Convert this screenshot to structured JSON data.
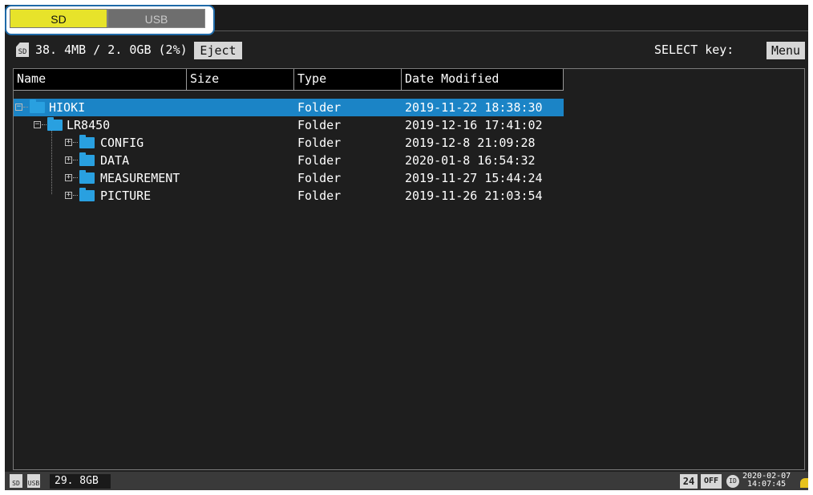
{
  "tabs": [
    {
      "label": "SD",
      "active": true
    },
    {
      "label": "USB",
      "active": false
    }
  ],
  "info": {
    "media_icon": "SD",
    "storage": "38. 4MB / 2. 0GB (2%)",
    "eject_label": "Eject",
    "select_label": "SELECT key:",
    "menu_label": "Menu"
  },
  "columns": [
    "Name",
    "Size",
    "Type",
    "Date Modified"
  ],
  "rows": [
    {
      "name": "HIOKI",
      "size": "",
      "type": "Folder",
      "date": "2019-11-22 18:38:30",
      "selected": true,
      "expander": "−"
    },
    {
      "name": "LR8450",
      "size": "",
      "type": "Folder",
      "date": "2019-12-16 17:41:02",
      "selected": false,
      "expander": "−"
    },
    {
      "name": "CONFIG",
      "size": "",
      "type": "Folder",
      "date": "2019-12-8 21:09:28",
      "selected": false,
      "expander": "+"
    },
    {
      "name": "DATA",
      "size": "",
      "type": "Folder",
      "date": "2020-01-8 16:54:32",
      "selected": false,
      "expander": "+"
    },
    {
      "name": "MEASUREMENT",
      "size": "",
      "type": "Folder",
      "date": "2019-11-27 15:44:24",
      "selected": false,
      "expander": "+"
    },
    {
      "name": "PICTURE",
      "size": "",
      "type": "Folder",
      "date": "2019-11-26 21:03:54",
      "selected": false,
      "expander": "+"
    }
  ],
  "status": {
    "sd_icon": "SD",
    "usb_icon": "USB",
    "capacity": "29. 8GB",
    "box1": "24",
    "box2": "OFF",
    "circle": "ID",
    "date": "2020-02-07",
    "time": "14:07:45"
  },
  "colors": {
    "sd_tab": "#e7e32a",
    "selection": "#1b84c6",
    "folder": "#29a0e0"
  }
}
